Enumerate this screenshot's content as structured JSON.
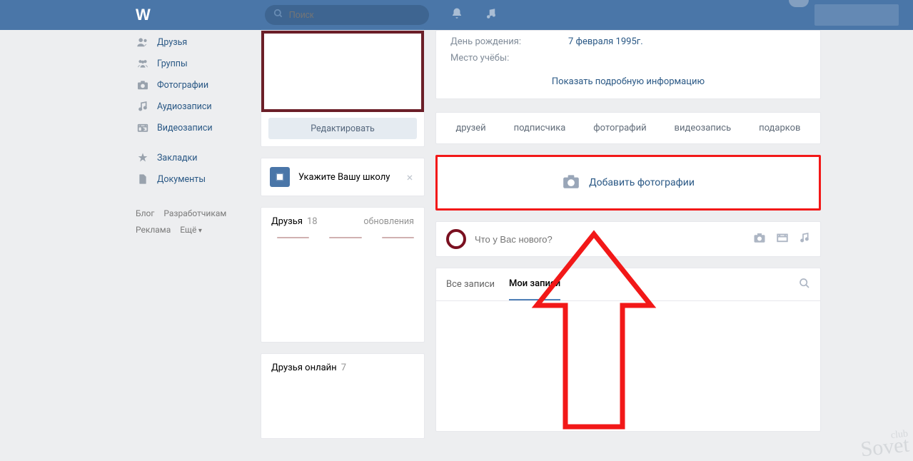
{
  "header": {
    "logo": "W",
    "search_placeholder": "Поиск"
  },
  "sidebar": {
    "items": [
      {
        "label": "Друзья"
      },
      {
        "label": "Группы"
      },
      {
        "label": "Фотографии"
      },
      {
        "label": "Аудиозаписи"
      },
      {
        "label": "Видеозаписи"
      },
      {
        "label": "Закладки"
      },
      {
        "label": "Документы"
      }
    ]
  },
  "footer": {
    "blog": "Блог",
    "devs": "Разработчикам",
    "ads": "Реклама",
    "more": "Ещё"
  },
  "profile": {
    "edit_label": "Редактировать",
    "school_prompt": "Укажите Вашу школу"
  },
  "friends": {
    "title": "Друзья",
    "count": "18",
    "updates": "обновления",
    "online_title": "Друзья онлайн",
    "online_count": "7"
  },
  "info": {
    "birthday_label": "День рождения:",
    "birthday_value": "7 февраля 1995г.",
    "study_label": "Место учёбы:",
    "show_more": "Показать подробную информацию"
  },
  "counts": {
    "friends": "друзей",
    "subs": "подписчика",
    "photos": "фотографий",
    "video": "видеозапись",
    "gifts": "подарков"
  },
  "add_photos_label": "Добавить фотографии",
  "newpost": {
    "placeholder": "Что у Вас нового?"
  },
  "tabs": {
    "all": "Все записи",
    "mine": "Мои записи"
  },
  "watermark": {
    "a": "club",
    "b": "Sovet"
  }
}
